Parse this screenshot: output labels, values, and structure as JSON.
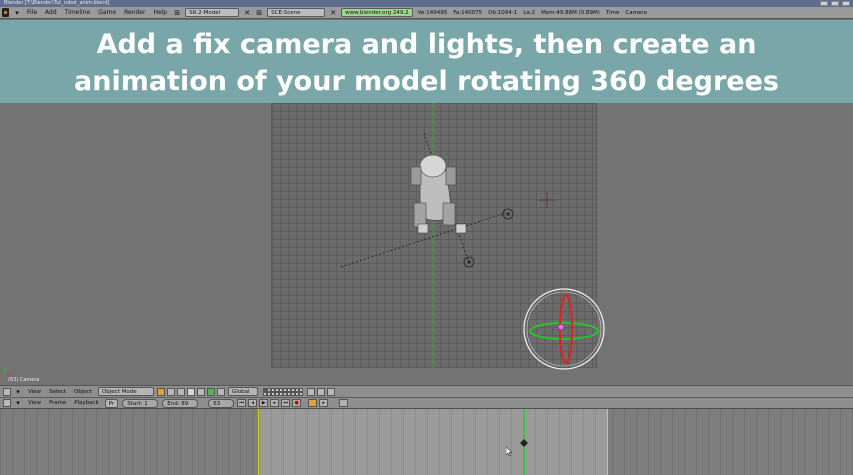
{
  "window": {
    "title": "Blender [T:\\Blender\\Tut_robot_anim.blend]"
  },
  "info_header": {
    "menus": [
      "File",
      "Add",
      "Timeline",
      "Game",
      "Render",
      "Help"
    ],
    "screen_field": "SR:2-Model",
    "scene_field": "SCE:Scene",
    "url": "www.blender.org 249.2",
    "stats": [
      "Ve:149495",
      "Fa:140075",
      "Ob:1094-1",
      "La:2",
      "Mem:49.88M (0.89M)",
      "Time",
      "Camera"
    ]
  },
  "caption": {
    "line1": "Add a fix camera and lights, then create an",
    "line2": "animation of your model rotating 360 degrees"
  },
  "viewport": {
    "frame_label": "(63) Camera"
  },
  "viewport_header": {
    "menus": [
      "View",
      "Select",
      "Object"
    ],
    "mode": "Object Mode",
    "orientation": "Global"
  },
  "timeline_header": {
    "menus": [
      "View",
      "Frame",
      "Playback"
    ],
    "pr_label": "Pr",
    "start": "Start: 1",
    "end": "End: 89",
    "current_frame": "63"
  },
  "colors": {
    "banner": "#7aaaac",
    "frame_range": "#d8d800",
    "current_frame_line": "#44c444"
  }
}
